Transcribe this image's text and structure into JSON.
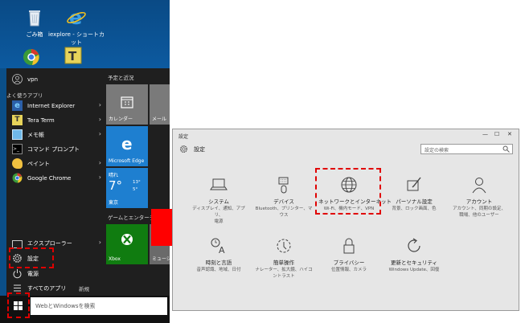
{
  "desktop": {
    "icons": [
      {
        "label": "ごみ箱"
      },
      {
        "label": "iexplore - ショートカット"
      }
    ]
  },
  "start_menu": {
    "user": "vpn",
    "frequent_header": "よく使うアプリ",
    "apps": [
      {
        "label": "Internet Explorer"
      },
      {
        "label": "Tera Term"
      },
      {
        "label": "メモ帳"
      },
      {
        "label": "コマンド プロンプト"
      },
      {
        "label": "ペイント"
      },
      {
        "label": "Google Chrome"
      }
    ],
    "explorer": "エクスプローラー",
    "settings": "設定",
    "power": "電源",
    "all_apps": "すべてのアプリ",
    "new_badge": "新規",
    "tiles_header": "予定と近況",
    "games_header": "ゲームとエンターテイメント",
    "tiles": {
      "calendar": "カレンダー",
      "mail": "メール",
      "edge": "Microsoft Edge",
      "weather_cond": "晴れ",
      "weather_temp": "7°",
      "weather_hi": "13°",
      "weather_lo": "5°",
      "weather_city": "東京",
      "xbox": "Xbox",
      "music": "ミュージ"
    }
  },
  "taskbar": {
    "search_placeholder": "WebとWindowsを検索"
  },
  "settings_window": {
    "title": "設定",
    "header": "設定",
    "search_placeholder": "設定の検索",
    "categories": [
      {
        "name": "システム",
        "desc": [
          "ディスプレイ、通知、アプリ、",
          "電源"
        ]
      },
      {
        "name": "デバイス",
        "desc": [
          "Bluetooth、プリンター、マ",
          "ウス"
        ]
      },
      {
        "name": "ネットワークとインターネット",
        "desc": [
          "Wi-Fi、機内モード、VPN"
        ]
      },
      {
        "name": "パーソナル設定",
        "desc": [
          "背景、ロック画面、色"
        ]
      },
      {
        "name": "アカウント",
        "desc": [
          "アカウント、同期の設定、",
          "職場、他のユーザー"
        ]
      },
      {
        "name": "時刻と言語",
        "desc": [
          "音声認識、地域、日付"
        ]
      },
      {
        "name": "簡単操作",
        "desc": [
          "ナレーター、拡大鏡、ハイコ",
          "ントラスト"
        ]
      },
      {
        "name": "プライバシー",
        "desc": [
          "位置情報、カメラ"
        ]
      },
      {
        "name": "更新とセキュリティ",
        "desc": [
          "Windows Update、回復"
        ]
      }
    ]
  }
}
